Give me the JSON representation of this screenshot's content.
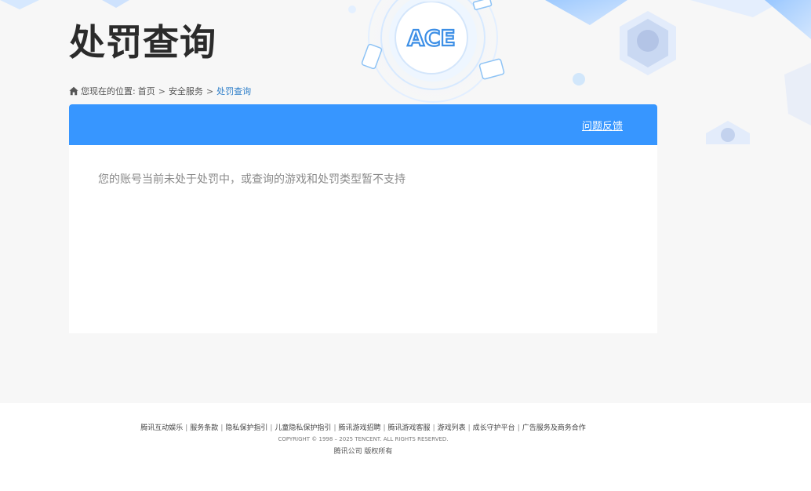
{
  "header": {
    "title": "处罚查询",
    "logo_text": "ACE"
  },
  "breadcrumb": {
    "prefix": "您现在的位置:",
    "items": [
      "首页",
      "安全服务"
    ],
    "separator": ">",
    "current": "处罚查询"
  },
  "panel": {
    "feedback_label": "问题反馈",
    "message": "您的账号当前未处于处罚中，或查询的游戏和处罚类型暂不支持"
  },
  "footer": {
    "links": [
      "腾讯互动娱乐",
      "服务条款",
      "隐私保护指引",
      "儿童隐私保护指引",
      "腾讯游戏招聘",
      "腾讯游戏客服",
      "游戏列表",
      "成长守护平台",
      "广告服务及商务合作"
    ],
    "copyright": "COPYRIGHT © 1998 – 2025 TENCENT. ALL RIGHTS RESERVED.",
    "company": "腾讯公司 版权所有"
  },
  "colors": {
    "accent": "#3796ff",
    "breadcrumb_current": "#2f7fc9",
    "background": "#f7f7f7"
  }
}
